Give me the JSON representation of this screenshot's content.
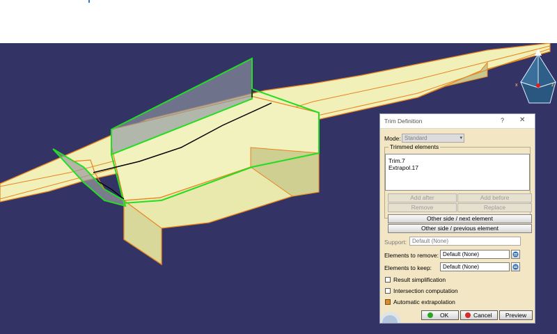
{
  "dialog": {
    "title": "Trim Definition",
    "help_icon_glyph": "?",
    "close_icon_glyph": "✕",
    "mode_label": "Mode:",
    "mode_value": "Standard",
    "trimmed_group_label": "Trimmed elements",
    "trimmed_items": [
      "Trim.7",
      "Extrapol.17"
    ],
    "add_after": "Add after",
    "add_before": "Add before",
    "remove": "Remove",
    "replace": "Replace",
    "other_next": "Other side / next element",
    "other_prev": "Other side / previous element",
    "support_label": "Support:",
    "support_value": "Default (None)",
    "remove_label": "Elements to remove:",
    "remove_value": "Default (None)",
    "keep_label": "Elements to keep:",
    "keep_value": "Default (None)",
    "result_simplification": {
      "label": "Result simplification",
      "checked": false
    },
    "intersection_computation": {
      "label": "Intersection computation",
      "checked": false
    },
    "automatic_extrapolation": {
      "label": "Automatic extrapolation",
      "checked": true
    },
    "ok": "OK",
    "cancel": "Cancel",
    "preview": "Preview"
  },
  "compass": {
    "x_label": "x",
    "z_label": "z"
  },
  "colors": {
    "viewport_background": "#333366",
    "surface": "#f0f0b8",
    "edge": "#e8841e",
    "highlight": "#22dd22",
    "dialog_background": "#f3e6c4"
  }
}
